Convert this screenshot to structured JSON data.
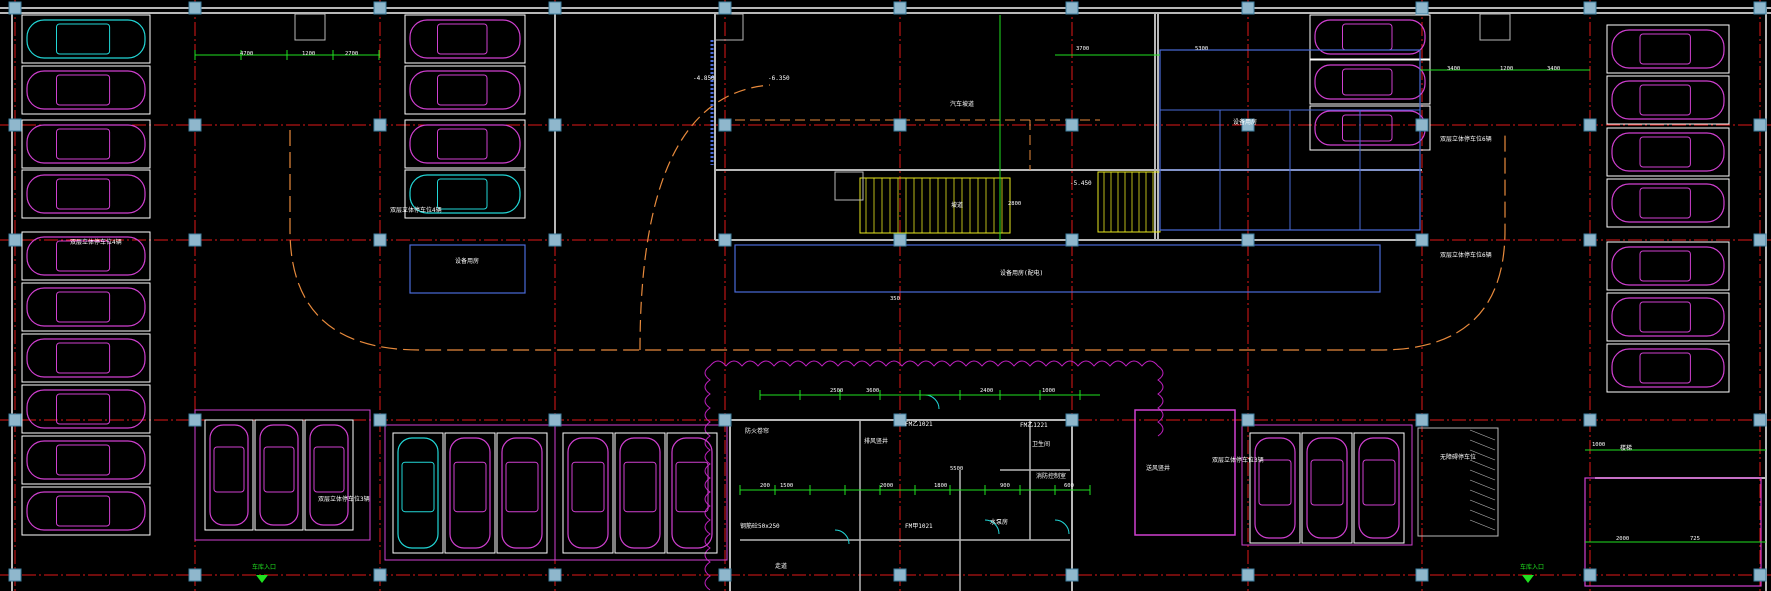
{
  "drawing": {
    "background": "#000000",
    "colors": {
      "wall": "#b8b8b8",
      "axis": "#e01818",
      "column_fill": "#8fb7cc",
      "column_stroke": "#3f7fa0",
      "car": "#d040d0",
      "car_highlight": "#22d7d7",
      "stall": "#ffffff",
      "dimension": "#20e020",
      "annotation": "#e8e8e8",
      "ramp": "#e8e820",
      "lane": "#e88a3c",
      "cloud": "#c020c0",
      "equipment": "#4a6bd8",
      "lift_room": "#d040d0"
    }
  },
  "labels": {
    "row_label_left": "双层立体停车位4辆",
    "row_label_right": "双层立体停车位6辆",
    "row_label_bottom_left": "双层立体停车位3辆",
    "row_label_bottom_right": "双层立体停车位3辆",
    "equipment_room_left": "设备用房",
    "equipment_room_right": "设备用房",
    "equipment_band": "设备用房(配电)",
    "ramp_word": "坡道",
    "ramp_note": "汽车坡道",
    "entrance_left": "车库入口",
    "entrance_right": "车库入口",
    "accessible_stall": "无障碍停车位",
    "stairs": "楼梯",
    "fire_room": "消防控制室",
    "pump_room": "水泵房",
    "toilet": "卫生间",
    "corridor": "走道",
    "ref_1": "FM乙1021",
    "ref_2": "FM乙1221",
    "ref_3": "FM甲1021",
    "level_1": "-5.450",
    "level_2": "-6.350",
    "level_3": "-4.850",
    "note_1": "钢筋砼50x250",
    "note_2": "防火卷帘",
    "note_3": "排风竖井",
    "note_4": "送风竖井"
  },
  "dimensions": {
    "d_4700": "4700",
    "d_1200": "1200",
    "d_2700": "2700",
    "d_3700": "3700",
    "d_5300": "5300",
    "d_3400": "3400",
    "d_2500": "2500",
    "d_3600": "3600",
    "d_2400": "2400",
    "d_2800": "2800",
    "d_1000": "1000",
    "d_1500": "1500",
    "d_2000": "2000",
    "d_1800": "1800",
    "d_900": "900",
    "d_200": "200",
    "d_600": "600",
    "d_725": "725",
    "d_350": "350",
    "d_5500": "5500"
  }
}
